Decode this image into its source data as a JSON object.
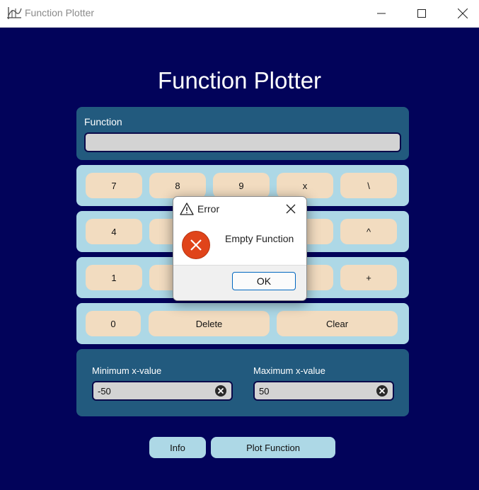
{
  "window": {
    "title": "Function Plotter",
    "icons": {
      "app": "plot-icon",
      "minimize": "minimize-icon",
      "maximize": "maximize-icon",
      "close": "close-icon"
    }
  },
  "main": {
    "heading": "Function Plotter",
    "function_label": "Function",
    "function_value": "",
    "keypad": {
      "row1": [
        "7",
        "8",
        "9",
        "x",
        "\\"
      ],
      "row2": [
        "4",
        "",
        "",
        "",
        "^"
      ],
      "row3": [
        "1",
        "",
        "",
        "",
        "+"
      ],
      "row4": [
        "0",
        "Delete",
        "Clear"
      ]
    },
    "range": {
      "min_label": "Minimum x-value",
      "min_value": "-50",
      "max_label": "Maximum x-value",
      "max_value": "50",
      "clear_icon": "clear-circle-icon"
    },
    "buttons": {
      "info": "Info",
      "plot": "Plot Function"
    }
  },
  "dialog": {
    "title": "Error",
    "title_icon": "warning-icon",
    "icon": "error-icon",
    "message": "Empty Function",
    "ok_label": "OK"
  },
  "colors": {
    "background": "#02035a",
    "panel": "#225a7e",
    "keypad_row": "#add8e6",
    "key": "#f2dcc0",
    "field": "#d3d3d3",
    "error": "#e0441a"
  }
}
